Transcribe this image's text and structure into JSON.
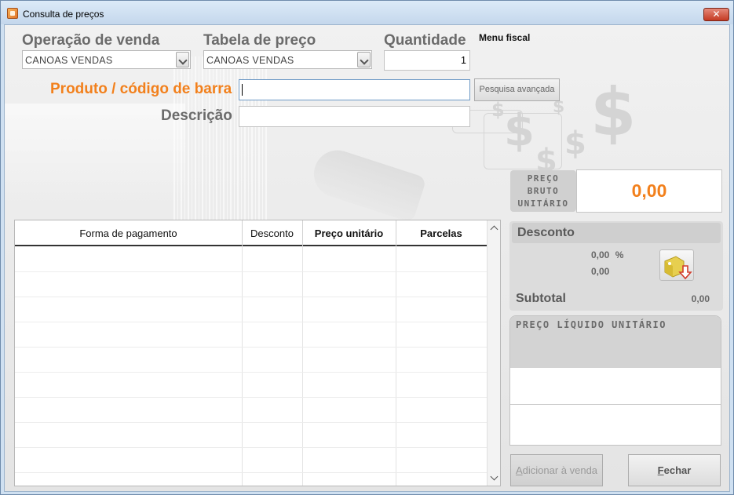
{
  "window": {
    "title": "Consulta de preços",
    "close_glyph": "✕"
  },
  "form": {
    "operacao_label": "Operação de venda",
    "operacao_value": "CANOAS VENDAS",
    "tabela_label": "Tabela de preço",
    "tabela_value": "CANOAS VENDAS",
    "quantidade_label": "Quantidade",
    "quantidade_value": "1",
    "menu_fiscal": "Menu fiscal",
    "produto_label": "Produto / código de barra",
    "produto_value": "",
    "pesquisa_button": "Pesquisa avançada",
    "descricao_label": "Descrição",
    "descricao_value": ""
  },
  "preco_bruto": {
    "label_line1": "Preço",
    "label_line2": "bruto",
    "label_line3": "unitário",
    "value": "0,00"
  },
  "desconto": {
    "title": "Desconto",
    "percent": "0,00",
    "percent_unit": "%",
    "value": "0,00",
    "icon": "discount-tag-icon"
  },
  "subtotal": {
    "label": "Subtotal",
    "value": "0,00"
  },
  "preco_liquido": {
    "label": "Preço líquido unitário"
  },
  "grid": {
    "columns": [
      "Forma de pagamento",
      "Desconto",
      "Preço unitário",
      "Parcelas"
    ],
    "rows": []
  },
  "actions": {
    "adicionar": "Adicionar à venda",
    "fechar": "Fechar"
  },
  "decor": {
    "dollar_glyph": "$"
  },
  "colors": {
    "accent_orange": "#f2801c",
    "label_gray": "#6b6b6b"
  }
}
